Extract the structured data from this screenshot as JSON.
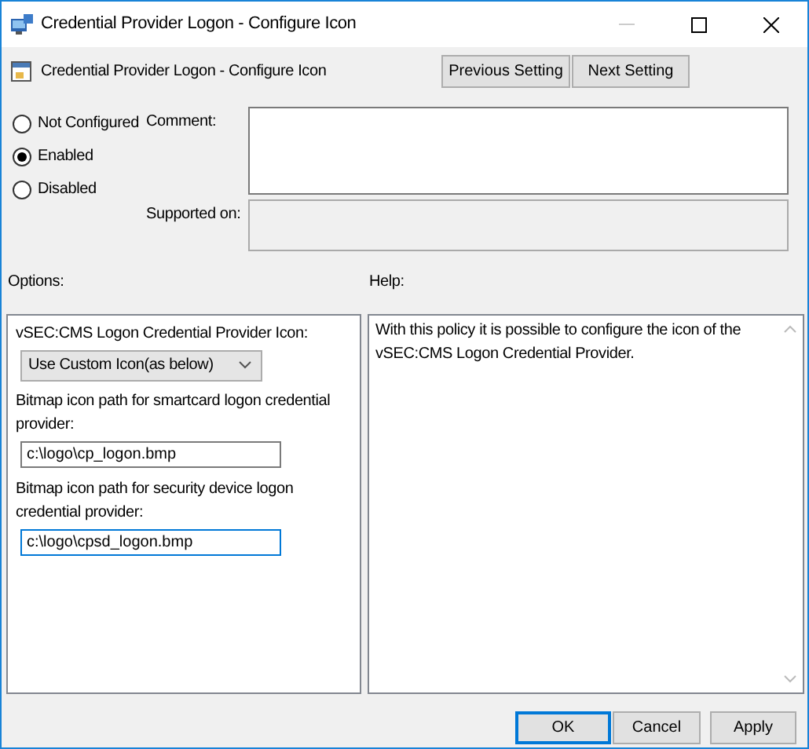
{
  "window": {
    "title": "Credential Provider Logon - Configure Icon"
  },
  "header": {
    "title": "Credential Provider Logon - Configure Icon",
    "buttons": [
      {
        "label": "Previous Setting"
      },
      {
        "label": "Next Setting"
      }
    ]
  },
  "state_options": [
    {
      "label": "Not Configured",
      "selected": false
    },
    {
      "label": "Enabled",
      "selected": true
    },
    {
      "label": "Disabled",
      "selected": false
    }
  ],
  "comment": {
    "label": "Comment:"
  },
  "supported_on": {
    "label": "Supported on:"
  },
  "options": {
    "label": "Options:",
    "items": [
      {
        "kind": "label",
        "text": "vSEC:CMS Logon Credential Provider Icon:"
      },
      {
        "kind": "dropdown",
        "value": "Use Custom Icon(as below)"
      },
      {
        "kind": "label",
        "text": "Bitmap icon path for smartcard logon credential provider:"
      },
      {
        "kind": "input",
        "value": "c:\\logo\\cp_logon.bmp",
        "focused": false
      },
      {
        "kind": "label",
        "text": "Bitmap icon path for security device logon credential provider:"
      },
      {
        "kind": "input",
        "value": "c:\\logo\\cpsd_logon.bmp",
        "focused": true
      }
    ]
  },
  "help": {
    "label": "Help:",
    "text": "With this policy it is possible to configure the icon of the vSEC:CMS Logon Credential Provider."
  },
  "footer_buttons": [
    {
      "label": "OK",
      "default": true
    },
    {
      "label": "Cancel",
      "default": false
    },
    {
      "label": "Apply",
      "default": false
    }
  ]
}
